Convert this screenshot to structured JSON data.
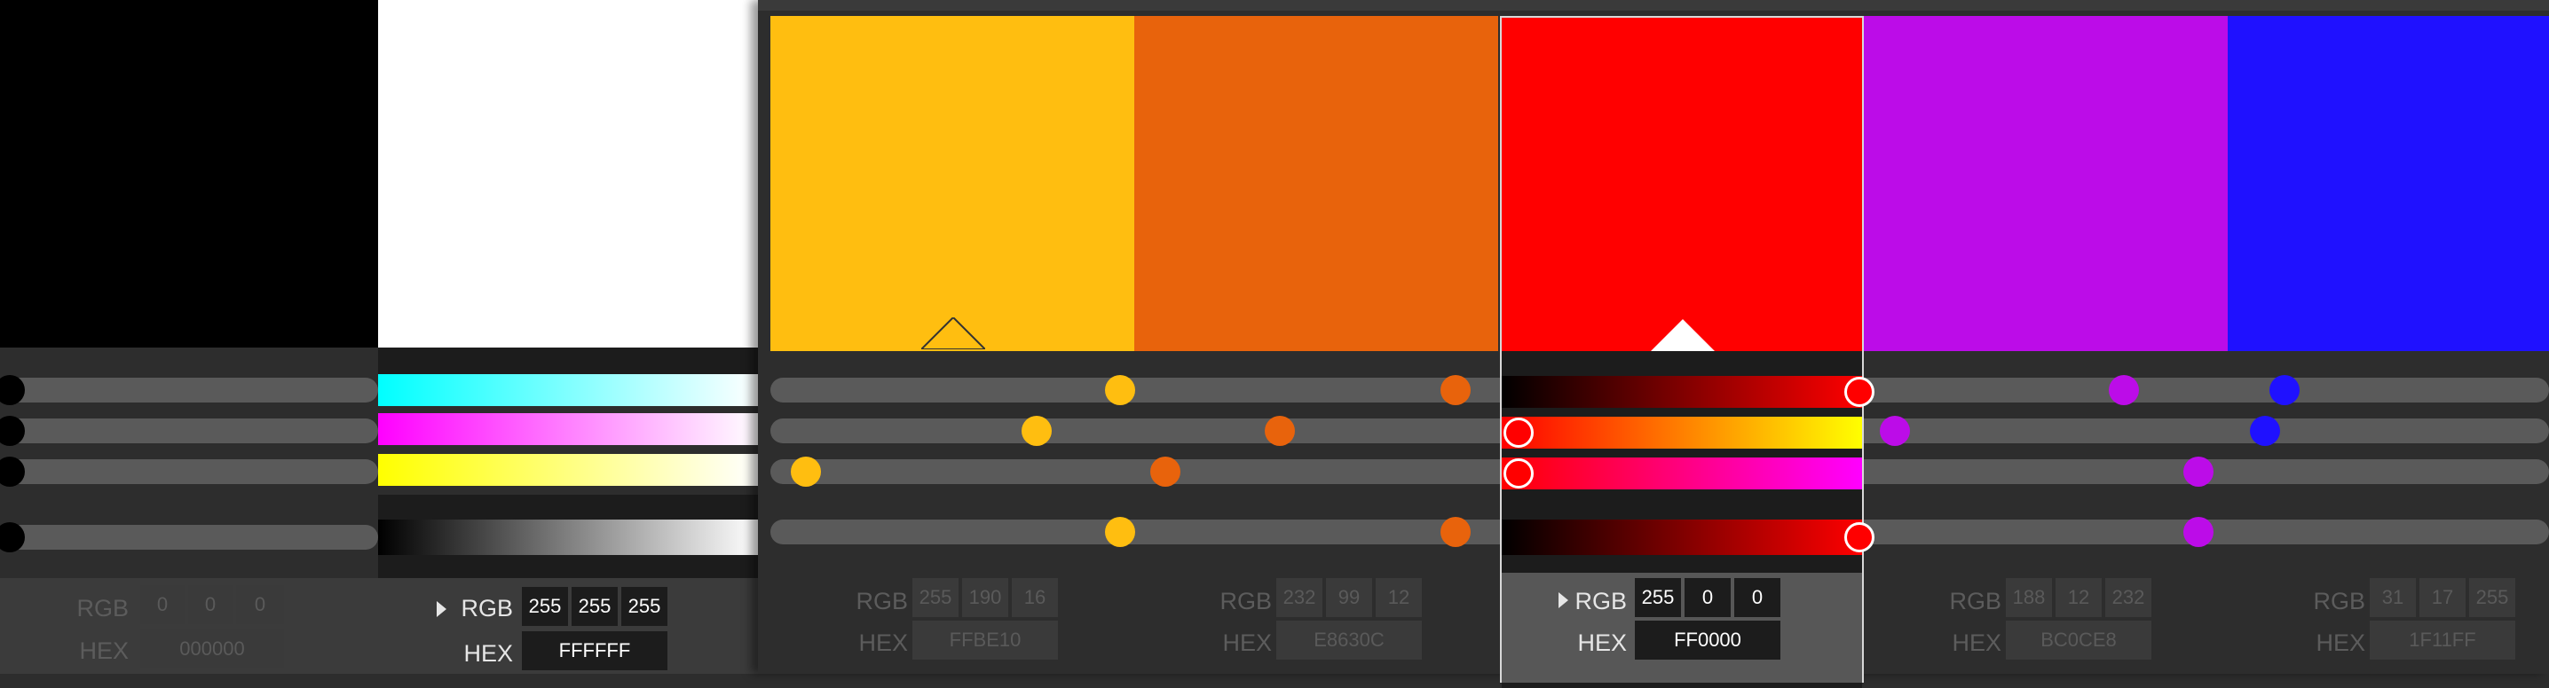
{
  "labels": {
    "rgb": "RGB",
    "hex": "HEX"
  },
  "colors": [
    {
      "id": "black",
      "hex": "000000",
      "rgb": [
        "0",
        "0",
        "0"
      ],
      "css": "#000000",
      "selected": false
    },
    {
      "id": "white",
      "hex": "FFFFFF",
      "rgb": [
        "255",
        "255",
        "255"
      ],
      "css": "#FFFFFF",
      "selected": true
    },
    {
      "id": "yellow",
      "hex": "FFBE10",
      "rgb": [
        "255",
        "190",
        "16"
      ],
      "css": "#FFBE10",
      "selected": false
    },
    {
      "id": "orange",
      "hex": "E8630C",
      "rgb": [
        "232",
        "99",
        "12"
      ],
      "css": "#E8630C",
      "selected": false
    },
    {
      "id": "red",
      "hex": "FF0000",
      "rgb": [
        "255",
        "0",
        "0"
      ],
      "css": "#FF0000",
      "selected": true
    },
    {
      "id": "purple",
      "hex": "BC0CE8",
      "rgb": [
        "188",
        "12",
        "232"
      ],
      "css": "#BC0CE8",
      "selected": false
    },
    {
      "id": "blue",
      "hex": "1F11FF",
      "rgb": [
        "31",
        "17",
        "255"
      ],
      "css": "#1F11FF",
      "selected": false
    }
  ],
  "icons": {
    "expand": "triangle-right-icon",
    "marker": "triangle-up-icon"
  }
}
